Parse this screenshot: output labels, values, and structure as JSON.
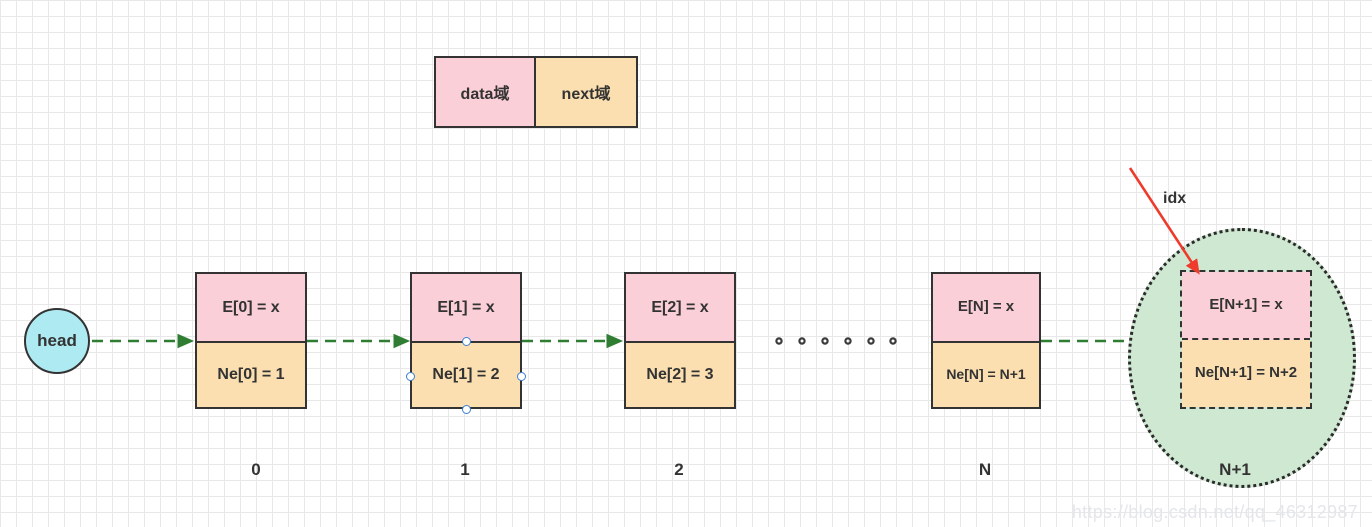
{
  "legend": {
    "data_label": "data域",
    "next_label": "next域",
    "data_color": "#fbcfd8",
    "next_color": "#fbdfb0"
  },
  "head": {
    "label": "head",
    "color": "#aeeaf2"
  },
  "nodes": [
    {
      "data": "E[0] = x",
      "next": "Ne[0] = 1",
      "index": "0",
      "selected": false,
      "dashed": false
    },
    {
      "data": "E[1] = x",
      "next": "Ne[1] = 2",
      "index": "1",
      "selected": true,
      "dashed": false
    },
    {
      "data": "E[2] = x",
      "next": "Ne[2] = 3",
      "index": "2",
      "selected": false,
      "dashed": false
    },
    {
      "data": "E[N] = x",
      "next": "Ne[N] = N+1",
      "index": "N",
      "selected": false,
      "dashed": false
    },
    {
      "data": "E[N+1] = x",
      "next": "Ne[N+1] = N+2",
      "index": "N+1",
      "selected": false,
      "dashed": true
    }
  ],
  "ellipsis": {
    "dot_count": 6
  },
  "annotation": {
    "idx_label": "idx",
    "arrow_color": "#ef3b2c"
  },
  "link_arrow_color": "#2e7d32",
  "watermark": "https://blog.csdn.net/qq_46312987"
}
